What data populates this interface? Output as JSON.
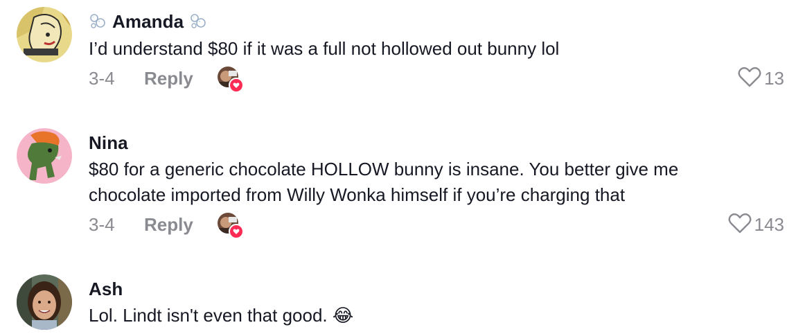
{
  "comments": [
    {
      "username": "Amanda",
      "decoration_icon": "bubbles-icon",
      "text_lines": [
        "I’d understand $80 if it was a full not hollowed out bunny lol"
      ],
      "date": "3-4",
      "reply_label": "Reply",
      "likes": "13",
      "creator_liked": true
    },
    {
      "username": "Nina",
      "text_lines": [
        "$80 for a generic chocolate HOLLOW bunny is insane. You better give me",
        "chocolate imported from Willy Wonka himself if you’re charging that"
      ],
      "date": "3-4",
      "reply_label": "Reply",
      "likes": "143",
      "creator_liked": true
    },
    {
      "username": "Ash",
      "text_lines": [
        "Lol. Lindt isn't even that good. "
      ],
      "emoji": "😂",
      "emoji_icon": "tears-of-joy-emoji-icon"
    }
  ],
  "colors": {
    "text": "#161823",
    "secondary": "#8a8b91",
    "heart_badge": "#fe2c55"
  }
}
